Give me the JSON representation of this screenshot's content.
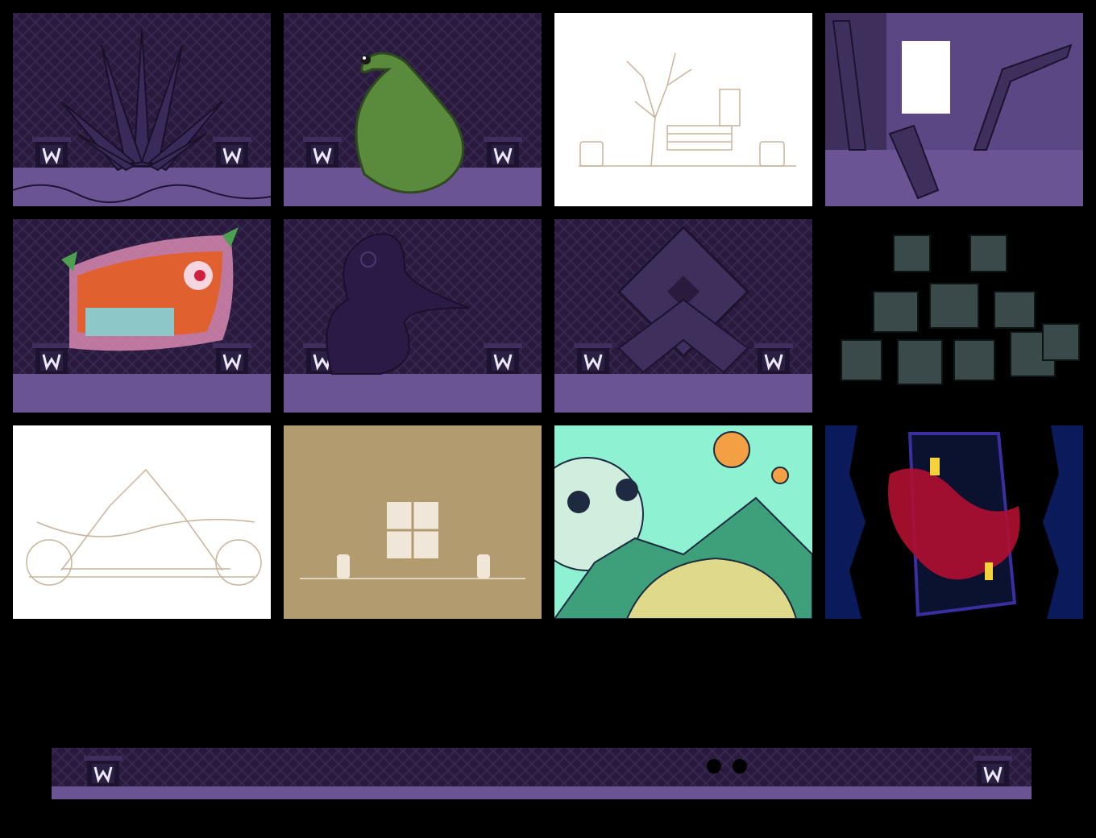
{
  "colors": {
    "background": "#000000",
    "wall_dark": "#2a1a3e",
    "wall_pattern": "#35264d",
    "floor_purple": "#6a5494",
    "sketch_bg": "#ffffff",
    "sketch_line": "#c9b49a",
    "sand_bg": "#b39b70",
    "mint_sky": "#8ef2d2",
    "navy": "#0a1a5a",
    "crimson": "#b01030"
  },
  "tiles": [
    {
      "name": "spiky-plant-backdrop",
      "icon": "spiky-plant-icon"
    },
    {
      "name": "green-curl-creature-backdrop",
      "icon": "green-curl-icon"
    },
    {
      "name": "tree-sketch-backdrop",
      "icon": "tree-sketch-icon"
    },
    {
      "name": "broken-room-backdrop",
      "icon": "broken-pillars-icon"
    },
    {
      "name": "graffiti-backdrop",
      "icon": "graffiti-icon"
    },
    {
      "name": "bird-silhouette-backdrop",
      "icon": "bird-icon"
    },
    {
      "name": "diamond-emblem-backdrop",
      "icon": "diamond-icon"
    },
    {
      "name": "stone-cubes-backdrop",
      "icon": "cubes-icon"
    },
    {
      "name": "mountain-sketch-backdrop",
      "icon": "mountain-sketch-icon"
    },
    {
      "name": "window-silhouette-backdrop",
      "icon": "window-icon"
    },
    {
      "name": "pastel-mountain-backdrop",
      "icon": "pastel-mountain-icon"
    },
    {
      "name": "crimson-tower-backdrop",
      "icon": "tower-icon"
    }
  ],
  "bottom_strip": {
    "name": "wide-stage-strip",
    "icon": "stage-eyes-icon"
  }
}
